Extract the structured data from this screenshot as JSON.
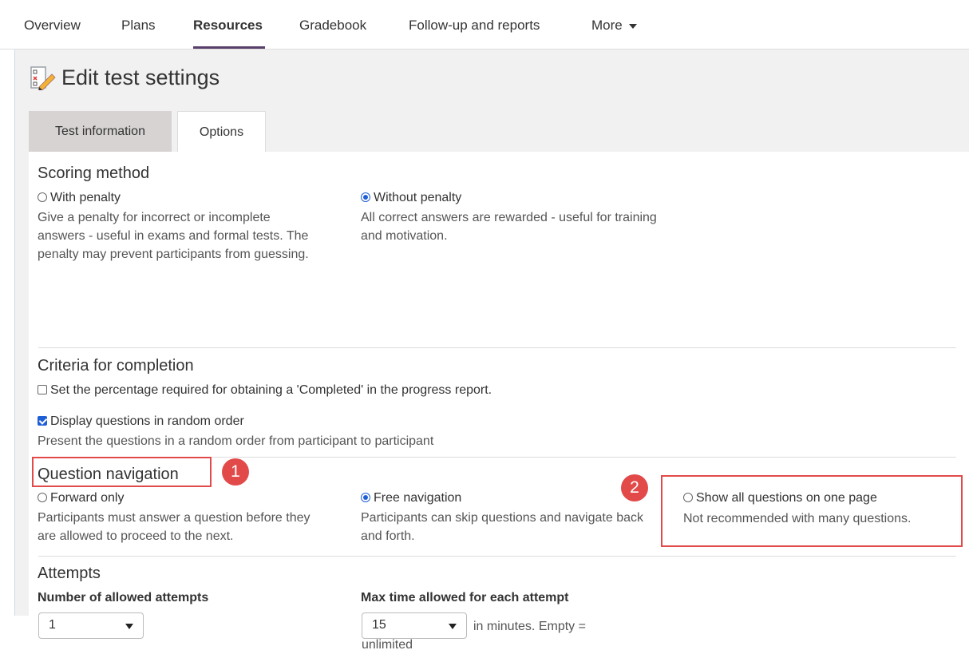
{
  "nav": {
    "items": [
      "Overview",
      "Plans",
      "Resources",
      "Gradebook",
      "Follow-up and reports",
      "More"
    ],
    "active": "Resources"
  },
  "page": {
    "title": "Edit test settings"
  },
  "tabs": [
    "Test information",
    "Options"
  ],
  "scoring": {
    "title": "Scoring method",
    "with_penalty": {
      "label": "With penalty",
      "desc": "Give a penalty for incorrect or incomplete answers - useful in exams and formal tests. The penalty may prevent participants from guessing."
    },
    "without_penalty": {
      "label": "Without penalty",
      "desc": "All correct answers are rewarded - useful for training and motivation."
    }
  },
  "completion": {
    "title": "Criteria for completion",
    "percentage_label": "Set the percentage required for obtaining a 'Completed' in the progress report.",
    "random_label": "Display questions in random order",
    "random_desc": "Present the questions in a random order from participant to participant"
  },
  "navigation": {
    "title": "Question navigation",
    "forward": {
      "label": "Forward only",
      "desc": "Participants must answer a question before they are allowed to proceed to the next."
    },
    "free": {
      "label": "Free navigation",
      "desc": "Participants can skip questions and navigate back and forth."
    },
    "all": {
      "label": "Show all questions on one page",
      "desc": "Not recommended with many questions."
    }
  },
  "attempts": {
    "title": "Attempts",
    "number_label": "Number of allowed attempts",
    "number_value": "1",
    "time_label": "Max time allowed for each attempt",
    "time_value": "15",
    "time_suffix": "in minutes. Empty = unlimited"
  },
  "annotations": {
    "badge1": "1",
    "badge2": "2"
  },
  "colors": {
    "accent": "#1f5fd6",
    "highlight": "#e24a4a",
    "nav_underline": "#5a3e6b"
  }
}
